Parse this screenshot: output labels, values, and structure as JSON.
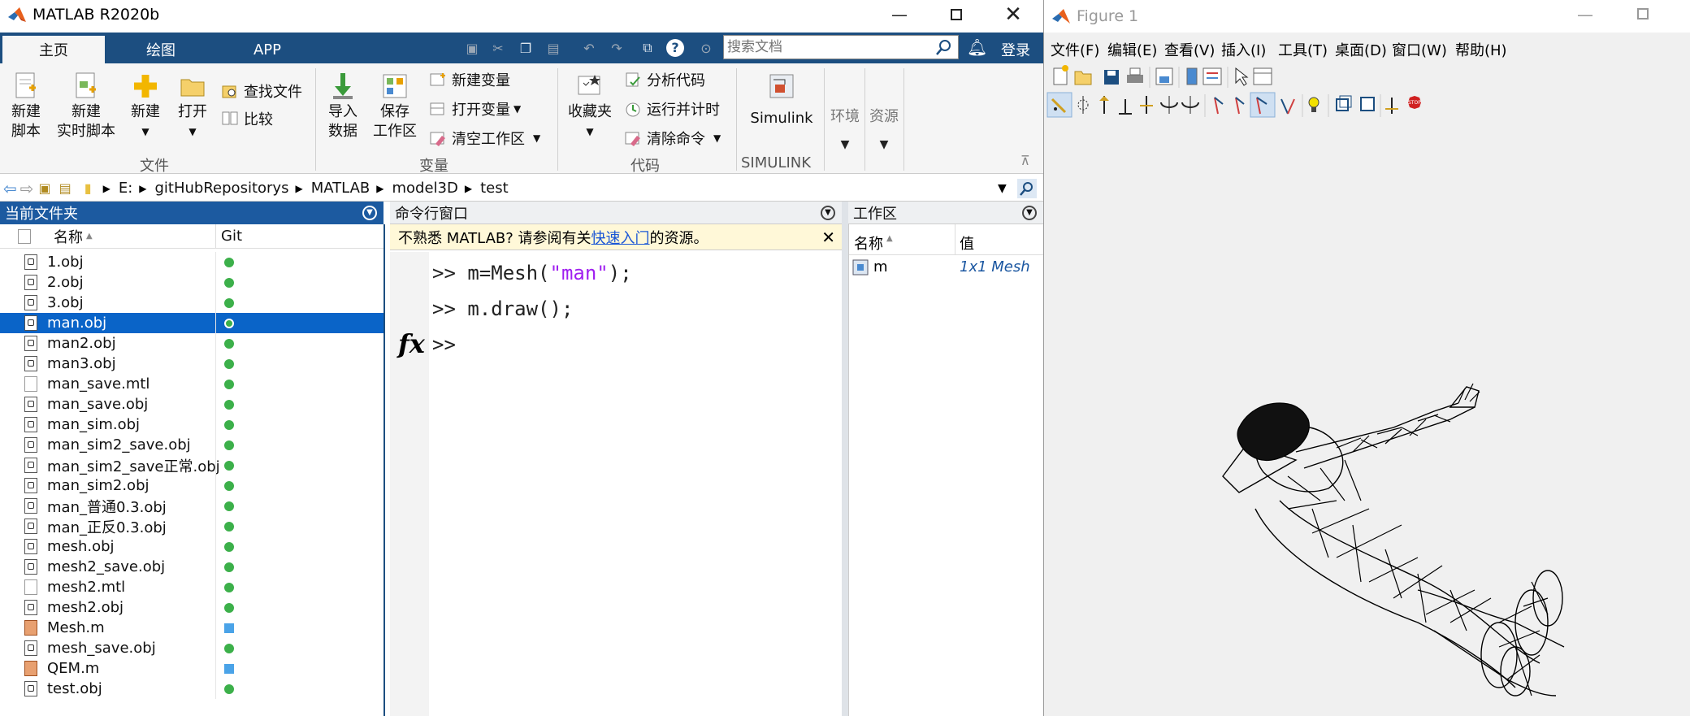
{
  "matlab": {
    "title": "MATLAB R2020b",
    "tabs": [
      "主页",
      "绘图",
      "APP"
    ],
    "search_placeholder": "搜索文档",
    "login": "登录",
    "ribbon": {
      "file_group": "文件",
      "new_script": [
        "新建",
        "脚本"
      ],
      "new_live_script": [
        "新建",
        "实时脚本"
      ],
      "new": "新建",
      "open": "打开",
      "find_files": "查找文件",
      "compare": "比较",
      "variable_group": "变量",
      "import_data": [
        "导入",
        "数据"
      ],
      "save_workspace": [
        "保存",
        "工作区"
      ],
      "new_variable": "新建变量",
      "open_variable": "打开变量",
      "clear_workspace": "清空工作区",
      "code_group": "代码",
      "favorites": "收藏夹",
      "analyze_code": "分析代码",
      "run_and_time": "运行并计时",
      "clear_commands": "清除命令",
      "simulink_group": "SIMULINK",
      "simulink": "Simulink",
      "environment": "环境",
      "resources": "资源"
    },
    "path": [
      "E:",
      "gitHubRepositorys",
      "MATLAB",
      "model3D",
      "test"
    ],
    "current_folder": {
      "title": "当前文件夹",
      "col_name": "名称",
      "col_git": "Git",
      "files": [
        {
          "name": "1.obj",
          "type": "obj",
          "git": "dot"
        },
        {
          "name": "2.obj",
          "type": "obj",
          "git": "dot"
        },
        {
          "name": "3.obj",
          "type": "obj",
          "git": "dot"
        },
        {
          "name": "man.obj",
          "type": "obj",
          "git": "dot",
          "selected": true
        },
        {
          "name": "man2.obj",
          "type": "obj",
          "git": "dot"
        },
        {
          "name": "man3.obj",
          "type": "obj",
          "git": "dot"
        },
        {
          "name": "man_save.mtl",
          "type": "mtl",
          "git": "dot"
        },
        {
          "name": "man_save.obj",
          "type": "obj",
          "git": "dot"
        },
        {
          "name": "man_sim.obj",
          "type": "obj",
          "git": "dot"
        },
        {
          "name": "man_sim2_save.obj",
          "type": "obj",
          "git": "dot"
        },
        {
          "name": "man_sim2_save正常.obj",
          "type": "obj",
          "git": "dot"
        },
        {
          "name": "man_sim2.obj",
          "type": "obj",
          "git": "dot"
        },
        {
          "name": "man_普通0.3.obj",
          "type": "obj",
          "git": "dot"
        },
        {
          "name": "man_正反0.3.obj",
          "type": "obj",
          "git": "dot"
        },
        {
          "name": "mesh.obj",
          "type": "obj",
          "git": "dot"
        },
        {
          "name": "mesh2_save.obj",
          "type": "obj",
          "git": "dot"
        },
        {
          "name": "mesh2.mtl",
          "type": "mtl",
          "git": "dot"
        },
        {
          "name": "mesh2.obj",
          "type": "obj",
          "git": "dot"
        },
        {
          "name": "Mesh.m",
          "type": "m",
          "git": "square"
        },
        {
          "name": "mesh_save.obj",
          "type": "obj",
          "git": "dot"
        },
        {
          "name": "QEM.m",
          "type": "m",
          "git": "square"
        },
        {
          "name": "test.obj",
          "type": "obj",
          "git": "dot"
        }
      ]
    },
    "command_window": {
      "title": "命令行窗口",
      "notice_prefix": "不熟悉 MATLAB? 请参阅有关",
      "notice_link": "快速入门",
      "notice_suffix": "的资源。",
      "lines": [
        {
          "prompt": ">>",
          "pre": " m=Mesh(",
          "str": "\"man\"",
          "post": ");"
        },
        {
          "prompt": ">>",
          "pre": " m.draw();",
          "str": "",
          "post": ""
        },
        {
          "prompt": ">>",
          "pre": "",
          "str": "",
          "post": ""
        }
      ],
      "fx": "fx"
    },
    "workspace": {
      "title": "工作区",
      "col_name": "名称",
      "col_value": "值",
      "vars": [
        {
          "name": "m",
          "value": "1x1 Mesh"
        }
      ]
    }
  },
  "figure": {
    "title": "Figure 1",
    "menu": [
      "文件(F)",
      "编辑(E)",
      "查看(V)",
      "插入(I)",
      "工具(T)",
      "桌面(D)",
      "窗口(W)",
      "帮助(H)"
    ]
  }
}
